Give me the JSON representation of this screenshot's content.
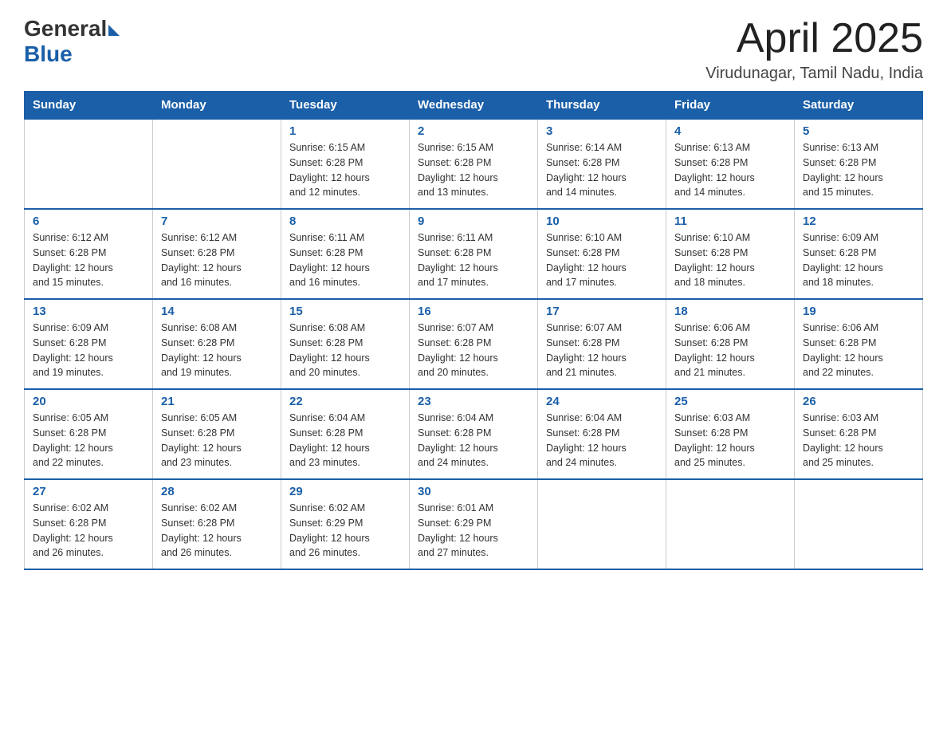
{
  "header": {
    "logo_general": "General",
    "logo_blue": "Blue",
    "title": "April 2025",
    "location": "Virudunagar, Tamil Nadu, India"
  },
  "days_of_week": [
    "Sunday",
    "Monday",
    "Tuesday",
    "Wednesday",
    "Thursday",
    "Friday",
    "Saturday"
  ],
  "weeks": [
    [
      {
        "day": "",
        "info": ""
      },
      {
        "day": "",
        "info": ""
      },
      {
        "day": "1",
        "info": "Sunrise: 6:15 AM\nSunset: 6:28 PM\nDaylight: 12 hours\nand 12 minutes."
      },
      {
        "day": "2",
        "info": "Sunrise: 6:15 AM\nSunset: 6:28 PM\nDaylight: 12 hours\nand 13 minutes."
      },
      {
        "day": "3",
        "info": "Sunrise: 6:14 AM\nSunset: 6:28 PM\nDaylight: 12 hours\nand 14 minutes."
      },
      {
        "day": "4",
        "info": "Sunrise: 6:13 AM\nSunset: 6:28 PM\nDaylight: 12 hours\nand 14 minutes."
      },
      {
        "day": "5",
        "info": "Sunrise: 6:13 AM\nSunset: 6:28 PM\nDaylight: 12 hours\nand 15 minutes."
      }
    ],
    [
      {
        "day": "6",
        "info": "Sunrise: 6:12 AM\nSunset: 6:28 PM\nDaylight: 12 hours\nand 15 minutes."
      },
      {
        "day": "7",
        "info": "Sunrise: 6:12 AM\nSunset: 6:28 PM\nDaylight: 12 hours\nand 16 minutes."
      },
      {
        "day": "8",
        "info": "Sunrise: 6:11 AM\nSunset: 6:28 PM\nDaylight: 12 hours\nand 16 minutes."
      },
      {
        "day": "9",
        "info": "Sunrise: 6:11 AM\nSunset: 6:28 PM\nDaylight: 12 hours\nand 17 minutes."
      },
      {
        "day": "10",
        "info": "Sunrise: 6:10 AM\nSunset: 6:28 PM\nDaylight: 12 hours\nand 17 minutes."
      },
      {
        "day": "11",
        "info": "Sunrise: 6:10 AM\nSunset: 6:28 PM\nDaylight: 12 hours\nand 18 minutes."
      },
      {
        "day": "12",
        "info": "Sunrise: 6:09 AM\nSunset: 6:28 PM\nDaylight: 12 hours\nand 18 minutes."
      }
    ],
    [
      {
        "day": "13",
        "info": "Sunrise: 6:09 AM\nSunset: 6:28 PM\nDaylight: 12 hours\nand 19 minutes."
      },
      {
        "day": "14",
        "info": "Sunrise: 6:08 AM\nSunset: 6:28 PM\nDaylight: 12 hours\nand 19 minutes."
      },
      {
        "day": "15",
        "info": "Sunrise: 6:08 AM\nSunset: 6:28 PM\nDaylight: 12 hours\nand 20 minutes."
      },
      {
        "day": "16",
        "info": "Sunrise: 6:07 AM\nSunset: 6:28 PM\nDaylight: 12 hours\nand 20 minutes."
      },
      {
        "day": "17",
        "info": "Sunrise: 6:07 AM\nSunset: 6:28 PM\nDaylight: 12 hours\nand 21 minutes."
      },
      {
        "day": "18",
        "info": "Sunrise: 6:06 AM\nSunset: 6:28 PM\nDaylight: 12 hours\nand 21 minutes."
      },
      {
        "day": "19",
        "info": "Sunrise: 6:06 AM\nSunset: 6:28 PM\nDaylight: 12 hours\nand 22 minutes."
      }
    ],
    [
      {
        "day": "20",
        "info": "Sunrise: 6:05 AM\nSunset: 6:28 PM\nDaylight: 12 hours\nand 22 minutes."
      },
      {
        "day": "21",
        "info": "Sunrise: 6:05 AM\nSunset: 6:28 PM\nDaylight: 12 hours\nand 23 minutes."
      },
      {
        "day": "22",
        "info": "Sunrise: 6:04 AM\nSunset: 6:28 PM\nDaylight: 12 hours\nand 23 minutes."
      },
      {
        "day": "23",
        "info": "Sunrise: 6:04 AM\nSunset: 6:28 PM\nDaylight: 12 hours\nand 24 minutes."
      },
      {
        "day": "24",
        "info": "Sunrise: 6:04 AM\nSunset: 6:28 PM\nDaylight: 12 hours\nand 24 minutes."
      },
      {
        "day": "25",
        "info": "Sunrise: 6:03 AM\nSunset: 6:28 PM\nDaylight: 12 hours\nand 25 minutes."
      },
      {
        "day": "26",
        "info": "Sunrise: 6:03 AM\nSunset: 6:28 PM\nDaylight: 12 hours\nand 25 minutes."
      }
    ],
    [
      {
        "day": "27",
        "info": "Sunrise: 6:02 AM\nSunset: 6:28 PM\nDaylight: 12 hours\nand 26 minutes."
      },
      {
        "day": "28",
        "info": "Sunrise: 6:02 AM\nSunset: 6:28 PM\nDaylight: 12 hours\nand 26 minutes."
      },
      {
        "day": "29",
        "info": "Sunrise: 6:02 AM\nSunset: 6:29 PM\nDaylight: 12 hours\nand 26 minutes."
      },
      {
        "day": "30",
        "info": "Sunrise: 6:01 AM\nSunset: 6:29 PM\nDaylight: 12 hours\nand 27 minutes."
      },
      {
        "day": "",
        "info": ""
      },
      {
        "day": "",
        "info": ""
      },
      {
        "day": "",
        "info": ""
      }
    ]
  ]
}
